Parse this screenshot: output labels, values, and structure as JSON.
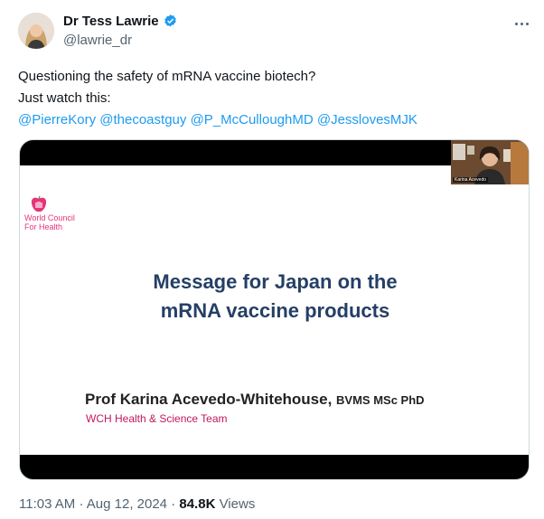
{
  "author": {
    "display_name": "Dr Tess Lawrie",
    "handle": "@lawrie_dr",
    "verified": true,
    "avatar_icon": "profile-photo"
  },
  "tweet": {
    "line1": "Questioning the safety of mRNA vaccine biotech?",
    "line2": "Just watch this:",
    "mentions": [
      "@PierreKory",
      "@thecoastguy",
      "@P_McCulloughMD",
      "@JesslovesMJK"
    ]
  },
  "media": {
    "org_name_line1": "World Council",
    "org_name_line2": "For Health",
    "title_line1": "Message for Japan on the",
    "title_line2": "mRNA vaccine products",
    "speaker_name": "Prof Karina Acevedo-Whitehouse,",
    "speaker_credentials": "BVMS MSc PhD",
    "team": "WCH Health & Science Team",
    "cam_label": "Karina Acevedo"
  },
  "meta": {
    "time": "11:03 AM",
    "separator": "·",
    "date": "Aug 12, 2024",
    "views_count": "84.8K",
    "views_label": "Views"
  },
  "colors": {
    "mention": "#1d9bf0",
    "verified": "#1d9bf0",
    "slide_title": "#253f66",
    "team": "#c2185b",
    "logo": "#e6337a"
  }
}
